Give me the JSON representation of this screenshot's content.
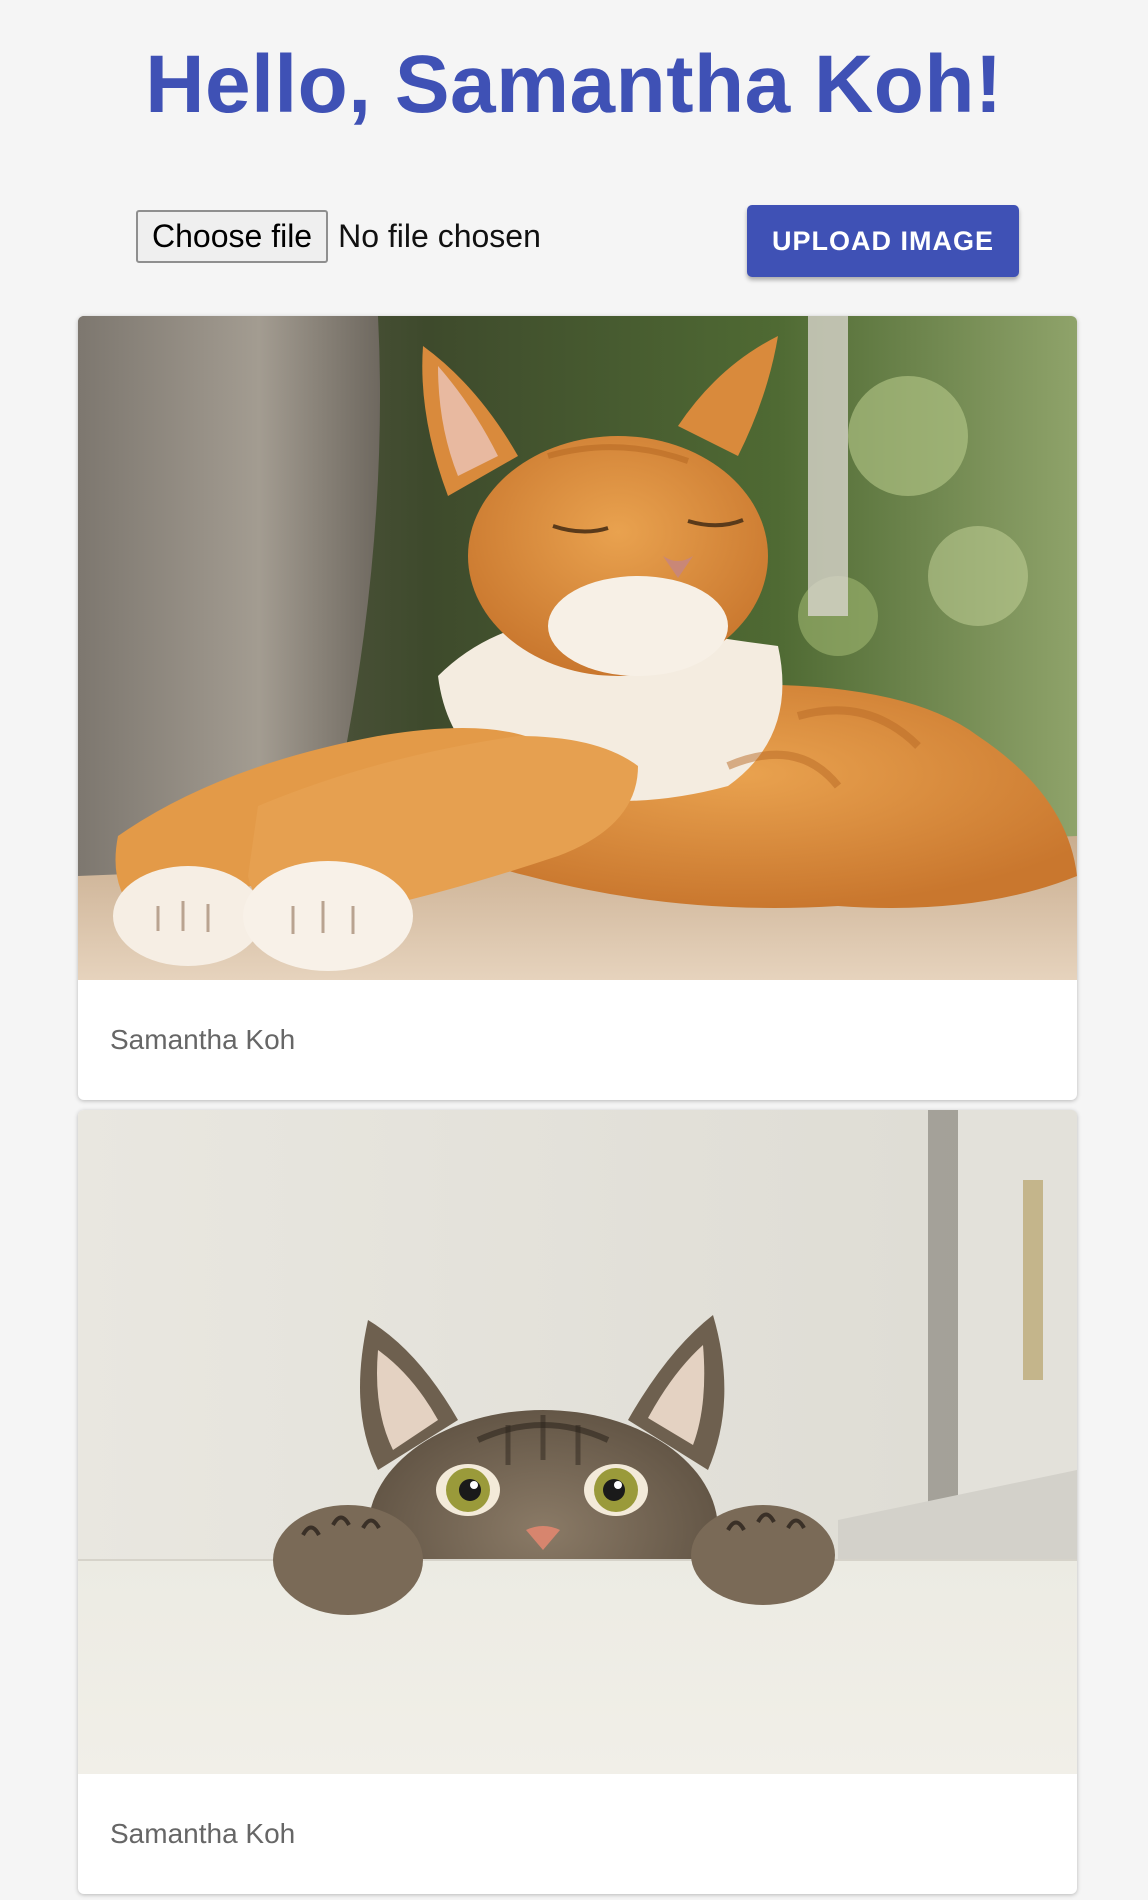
{
  "header": {
    "title": "Hello, Samantha Koh!"
  },
  "upload": {
    "choose_label": "Choose file",
    "status": "No file chosen",
    "button_label": "UPLOAD IMAGE"
  },
  "cards": [
    {
      "caption": "Samantha Koh",
      "image": "sleeping-orange-tabby-cat"
    },
    {
      "caption": "Samantha Koh",
      "image": "peeking-tabby-cat"
    }
  ],
  "colors": {
    "accent": "#3f51b5",
    "background": "#f5f5f5"
  }
}
